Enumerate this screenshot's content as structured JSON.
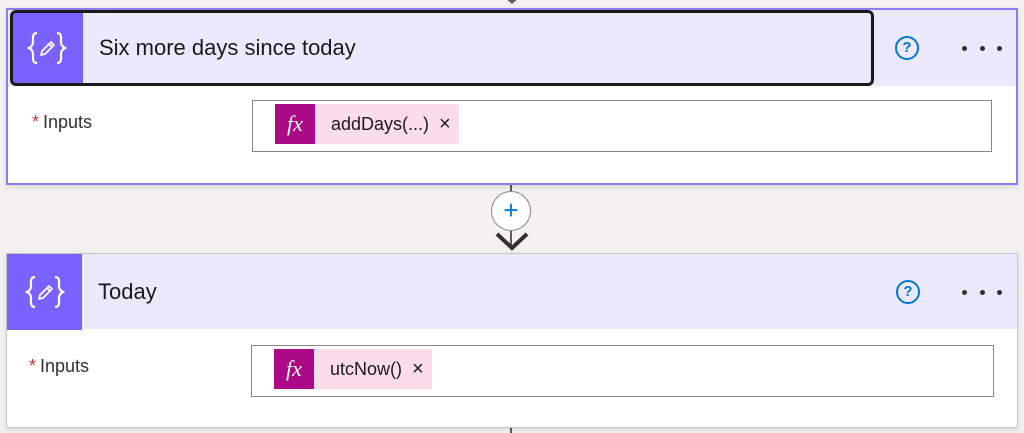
{
  "steps": [
    {
      "title": "Six more days since today",
      "inputs_label": "Inputs",
      "required_mark": "*",
      "token_icon": "fx",
      "token_text": "addDays(...)",
      "remove_icon": "×"
    },
    {
      "title": "Today",
      "inputs_label": "Inputs",
      "required_mark": "*",
      "token_icon": "fx",
      "token_text": "utcNow()",
      "remove_icon": "×"
    }
  ],
  "help_icon_glyph": "?",
  "add_step_glyph": "+",
  "colors": {
    "action_icon": "#7b61ff",
    "header_bg": "#ece8fd",
    "selected_border": "#8c7cf0",
    "token_icon_bg": "#ab0985",
    "token_bg": "#fbdcea",
    "help": "#0078d4",
    "required": "#d13438"
  }
}
